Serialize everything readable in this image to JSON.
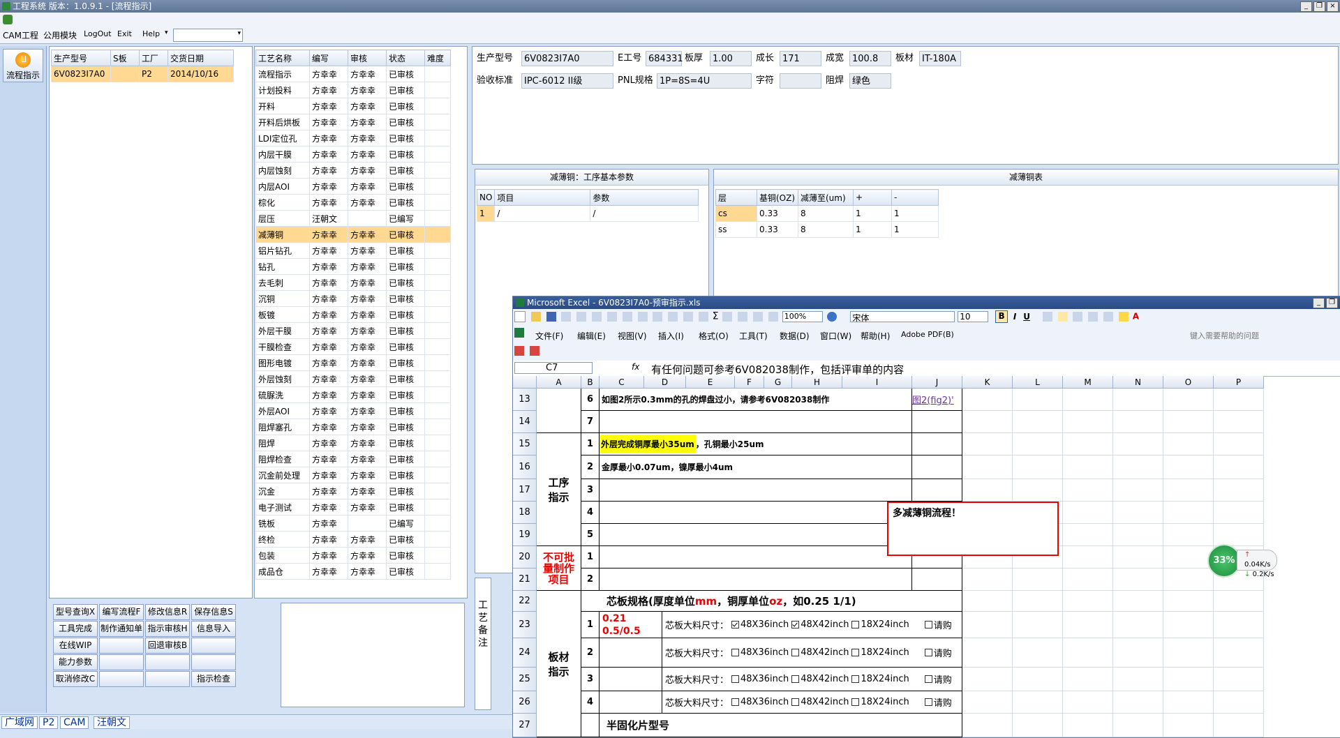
{
  "title": "工程系统    版本：1.0.9.1 - [流程指示]",
  "menu": [
    "CAM工程",
    "公用模块",
    "LogOut",
    "Exit",
    "Help"
  ],
  "left_strip": {
    "flow_button": "流程指示"
  },
  "order_table": {
    "headers": [
      "生产型号",
      "S板",
      "工厂",
      "交货日期"
    ],
    "rows": [
      [
        "6V0823I7A0",
        "",
        "P2",
        "2014/10/16"
      ]
    ]
  },
  "process_table": {
    "headers": [
      "工艺名称",
      "编写",
      "审核",
      "状态",
      "难度"
    ],
    "rows": [
      [
        "流程指示",
        "方幸幸",
        "方幸幸",
        "已审核",
        ""
      ],
      [
        "计划投料",
        "方幸幸",
        "方幸幸",
        "已审核",
        ""
      ],
      [
        "开料",
        "方幸幸",
        "方幸幸",
        "已审核",
        ""
      ],
      [
        "开料后烘板",
        "方幸幸",
        "方幸幸",
        "已审核",
        ""
      ],
      [
        "LDI定位孔",
        "方幸幸",
        "方幸幸",
        "已审核",
        ""
      ],
      [
        "内层干膜",
        "方幸幸",
        "方幸幸",
        "已审核",
        ""
      ],
      [
        "内层蚀刻",
        "方幸幸",
        "方幸幸",
        "已审核",
        ""
      ],
      [
        "内层AOI",
        "方幸幸",
        "方幸幸",
        "已审核",
        ""
      ],
      [
        "棕化",
        "方幸幸",
        "方幸幸",
        "已审核",
        ""
      ],
      [
        "层压",
        "汪朝文",
        "",
        "已编写",
        ""
      ],
      [
        "减薄铜",
        "方幸幸",
        "方幸幸",
        "已审核",
        ""
      ],
      [
        "铝片钻孔",
        "方幸幸",
        "方幸幸",
        "已审核",
        ""
      ],
      [
        "钻孔",
        "方幸幸",
        "方幸幸",
        "已审核",
        ""
      ],
      [
        "去毛刺",
        "方幸幸",
        "方幸幸",
        "已审核",
        ""
      ],
      [
        "沉铜",
        "方幸幸",
        "方幸幸",
        "已审核",
        ""
      ],
      [
        "板镀",
        "方幸幸",
        "方幸幸",
        "已审核",
        ""
      ],
      [
        "外层干膜",
        "方幸幸",
        "方幸幸",
        "已审核",
        ""
      ],
      [
        "干膜检查",
        "方幸幸",
        "方幸幸",
        "已审核",
        ""
      ],
      [
        "图形电镀",
        "方幸幸",
        "方幸幸",
        "已审核",
        ""
      ],
      [
        "外层蚀刻",
        "方幸幸",
        "方幸幸",
        "已审核",
        ""
      ],
      [
        "硫脲洗",
        "方幸幸",
        "方幸幸",
        "已审核",
        ""
      ],
      [
        "外层AOI",
        "方幸幸",
        "方幸幸",
        "已审核",
        ""
      ],
      [
        "阻焊塞孔",
        "方幸幸",
        "方幸幸",
        "已审核",
        ""
      ],
      [
        "阻焊",
        "方幸幸",
        "方幸幸",
        "已审核",
        ""
      ],
      [
        "阻焊检查",
        "方幸幸",
        "方幸幸",
        "已审核",
        ""
      ],
      [
        "沉金前处理",
        "方幸幸",
        "方幸幸",
        "已审核",
        ""
      ],
      [
        "沉金",
        "方幸幸",
        "方幸幸",
        "已审核",
        ""
      ],
      [
        "电子测试",
        "方幸幸",
        "方幸幸",
        "已审核",
        ""
      ],
      [
        "铣板",
        "方幸幸",
        "",
        "已编写",
        ""
      ],
      [
        "终检",
        "方幸幸",
        "方幸幸",
        "已审核",
        ""
      ],
      [
        "包装",
        "方幸幸",
        "方幸幸",
        "已审核",
        ""
      ],
      [
        "成品仓",
        "方幸幸",
        "方幸幸",
        "已审核",
        ""
      ]
    ]
  },
  "bottom_buttons": [
    [
      "型号查询X",
      "编写流程F",
      "修改信息R",
      "保存信息S"
    ],
    [
      "工具完成",
      "制作通知单",
      "指示审核H",
      "信息导入"
    ],
    [
      "在线WIP",
      "",
      "回退审核B",
      ""
    ],
    [
      "能力参数",
      "",
      "",
      ""
    ],
    [
      "取消修改C",
      "",
      "",
      "指示检查"
    ]
  ],
  "info": {
    "labels": [
      "生产型号",
      "E工号",
      "板厚",
      "成长",
      "成宽",
      "板材",
      "验收标准",
      "PNL规格",
      "字符",
      "阻焊"
    ],
    "values": [
      "6V0823I7A0",
      "684331",
      "1.00",
      "171",
      "100.8",
      "IT-180A",
      "IPC-6012 II级",
      "1P=8S=4U",
      "",
      "绿色"
    ]
  },
  "params_section": {
    "title": "减薄铜：工序基本参数",
    "headers": [
      "NO",
      "项目",
      "参数"
    ],
    "rows": [
      [
        "1",
        "/",
        "/"
      ]
    ]
  },
  "copper_section": {
    "title": "减薄铜表",
    "headers": [
      "层",
      "基铜(OZ)",
      "减薄至(um)",
      "+",
      "-"
    ],
    "rows": [
      [
        "cs",
        "0.33",
        "8",
        "1",
        "1"
      ],
      [
        "ss",
        "0.33",
        "8",
        "1",
        "1"
      ]
    ]
  },
  "notes_label": "工艺备注",
  "status_tabs": [
    "广域网",
    "P2",
    "CAM",
    "汪朝文"
  ],
  "network": {
    "percent": "33%",
    "up": "0.04K/s",
    "down": "0.2K/s"
  },
  "excel": {
    "title": "Microsoft Excel - 6V0823I7A0-预审指示.xls",
    "menu": [
      "文件(F)",
      "编辑(E)",
      "视图(V)",
      "插入(I)",
      "格式(O)",
      "工具(T)",
      "数据(D)",
      "窗口(W)",
      "帮助(H)",
      "Adobe PDF(B)"
    ],
    "help_placeholder": "键入需要帮助的问题",
    "zoom": "100%",
    "font": "宋体",
    "font_size": "10",
    "name_box": "C7",
    "formula": "有任何问题可参考6V082038制作，包括评审单的内容",
    "columns": [
      "A",
      "B",
      "C",
      "D",
      "E",
      "F",
      "G",
      "H",
      "I",
      "J",
      "K",
      "L",
      "M",
      "N",
      "O",
      "P"
    ],
    "row_numbers": [
      "13",
      "14",
      "15",
      "16",
      "17",
      "18",
      "19",
      "20",
      "21",
      "22",
      "23",
      "24",
      "25",
      "26",
      "27"
    ],
    "row13_text": "如图2所示0.3mm的孔的焊盘过小，请参考6V082038制作",
    "row13_link": "图2(fig2)'",
    "row15_highlight": "外层完成铜厚最小35um",
    "row15_rest": "，孔铜最小25um",
    "row16_text": "金厚最小0.07um，镍厚最小4um",
    "section_process": "工序指示",
    "section_no_batch": "不可批量制作项目",
    "section_material": "板材指示",
    "comment": "多减薄铜流程！",
    "row22_title_a": "芯板规格(厚度单位",
    "row22_mm": "mm",
    "row22_title_b": "，铜厚单位",
    "row22_oz": "oz",
    "row22_title_c": "，如0.25 1/1)",
    "row23_value": "0.21 0.5/0.5",
    "core_size_label": "芯板大料尺寸：",
    "size_options": [
      "48X36inch",
      "48X42inch",
      "18X24inch",
      "请购"
    ],
    "row27_text": "半固化片型号",
    "b_numbers": [
      "6",
      "7",
      "1",
      "2",
      "3",
      "4",
      "5",
      "1",
      "2",
      "",
      "1",
      "2",
      "3",
      "4"
    ]
  }
}
